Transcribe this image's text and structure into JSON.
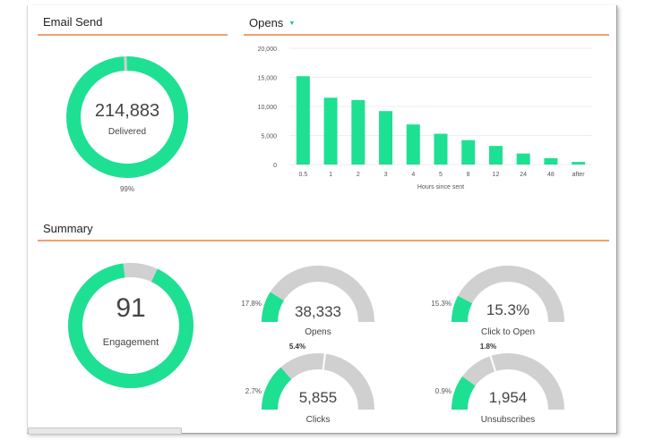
{
  "colors": {
    "accent": "#1ee092",
    "track": "#d0d0d0",
    "rule": "#f0a070",
    "text": "#333333"
  },
  "email_send": {
    "title": "Email Send",
    "value": "214,883",
    "label": "Delivered",
    "percent_text": "99%",
    "fraction": 0.99
  },
  "opens_panel": {
    "title": "Opens",
    "dropdown_icon": "caret-down-icon",
    "chart_data": {
      "type": "bar",
      "categories": [
        "0.5",
        "1",
        "2",
        "3",
        "4",
        "5",
        "8",
        "12",
        "24",
        "48",
        "after"
      ],
      "values": [
        15200,
        11500,
        11100,
        9200,
        6900,
        5300,
        4200,
        3200,
        1900,
        1100,
        450
      ],
      "xlabel": "Hours since sent",
      "ylim": [
        0,
        20000
      ],
      "yticks": [
        0,
        5000,
        10000,
        15000,
        20000
      ],
      "ytick_labels": [
        "0",
        "5,000",
        "10,000",
        "15,000",
        "20,000"
      ],
      "grid": true
    }
  },
  "summary": {
    "title": "Summary",
    "engagement": {
      "value": "91",
      "label": "Engagement",
      "fraction": 0.91
    },
    "gauges": [
      {
        "id": "opens",
        "value": "38,333",
        "label": "Opens",
        "left_pct": "17.8%",
        "fraction": 0.178
      },
      {
        "id": "click-to-open",
        "value": "15.3%",
        "label": "Click to Open",
        "left_pct": "15.3%",
        "fraction": 0.153
      },
      {
        "id": "clicks",
        "value": "5,855",
        "label": "Clicks",
        "left_pct": "2.7%",
        "top_pct": "5.4%",
        "fraction": 0.27,
        "marker_fraction": 0.54
      },
      {
        "id": "unsubscribes",
        "value": "1,954",
        "label": "Unsubscribes",
        "left_pct": "0.9%",
        "top_pct": "1.8%",
        "fraction": 0.2,
        "marker_fraction": 0.4
      }
    ]
  }
}
